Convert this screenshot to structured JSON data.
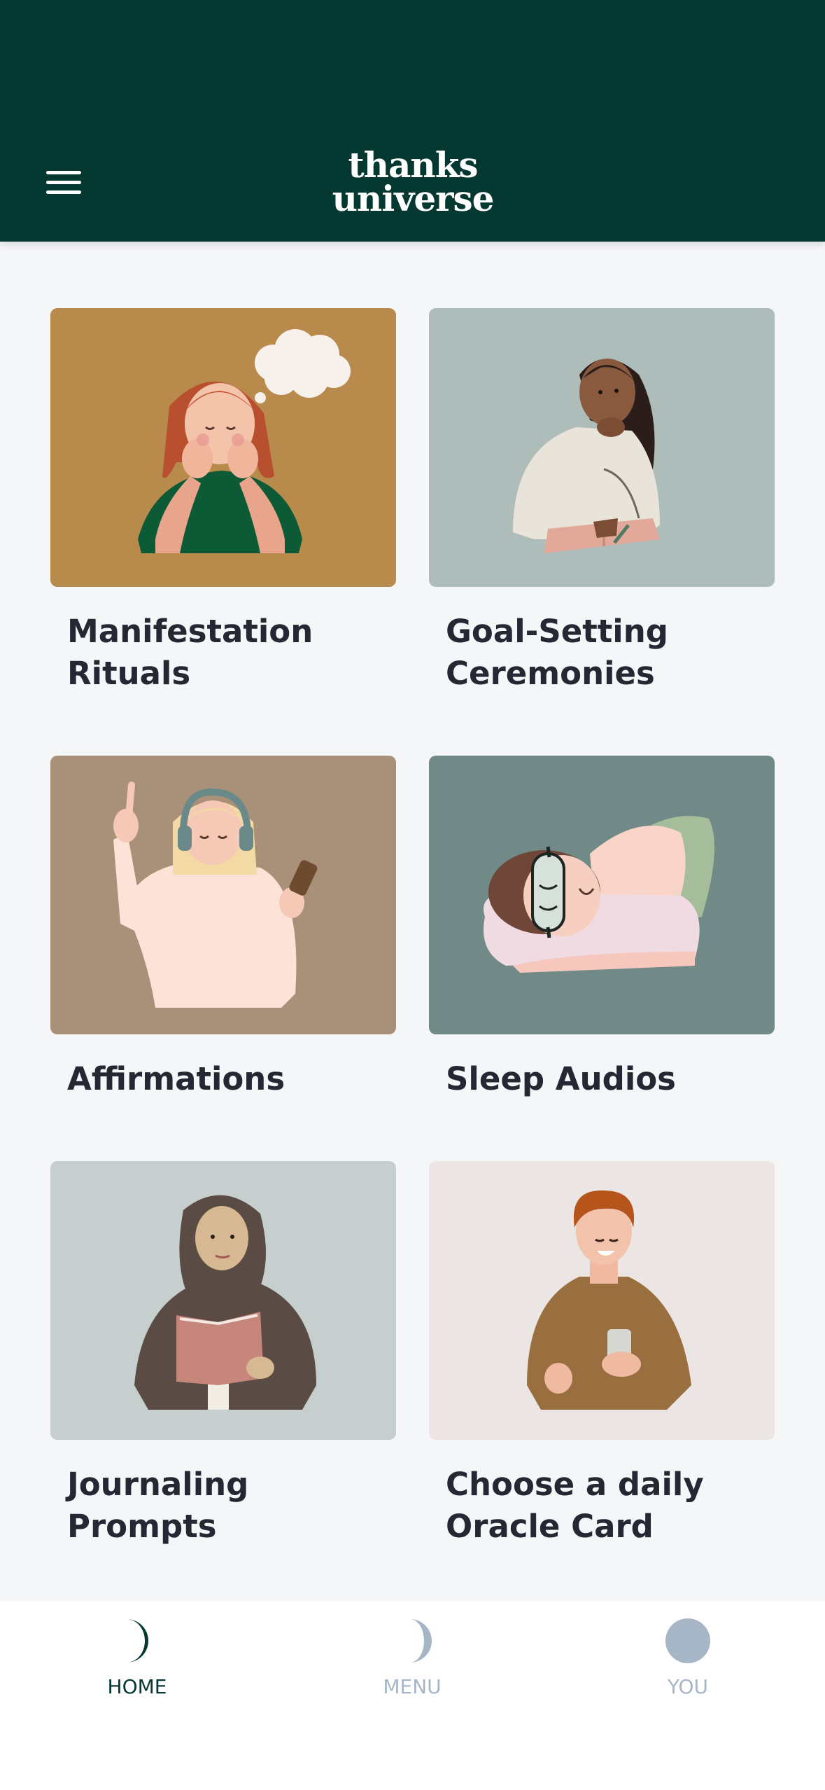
{
  "header": {
    "menu_icon": "hamburger-menu-icon",
    "logo_line1": "thanks",
    "logo_line2": "universe"
  },
  "cards": [
    {
      "title": "Manifestation\nRituals",
      "icon": "woman-daydreaming-illustration",
      "bg": "#b88b4d"
    },
    {
      "title": "Goal-Setting\nCeremonies",
      "icon": "woman-journaling-illustration",
      "bg": "#aebcba"
    },
    {
      "title": "Affirmations",
      "icon": "woman-with-headphones-illustration",
      "bg": "#a99179"
    },
    {
      "title": "Sleep Audios",
      "icon": "woman-sleeping-illustration",
      "bg": "#718a87"
    },
    {
      "title": "Journaling\nPrompts",
      "icon": "woman-reading-illustration",
      "bg": "#c6cfce"
    },
    {
      "title": "Choose a daily\nOracle Card",
      "icon": "man-with-phone-illustration",
      "bg": "#ebe5e3"
    }
  ],
  "tabs": [
    {
      "label": "HOME",
      "icon": "crescent-moon-icon",
      "active": true
    },
    {
      "label": "MENU",
      "icon": "half-moon-icon",
      "active": false
    },
    {
      "label": "YOU",
      "icon": "full-moon-icon",
      "active": false
    }
  ],
  "colors": {
    "header": "#063832",
    "active_tab": "#063832",
    "inactive_tab": "#a7b6c6"
  }
}
